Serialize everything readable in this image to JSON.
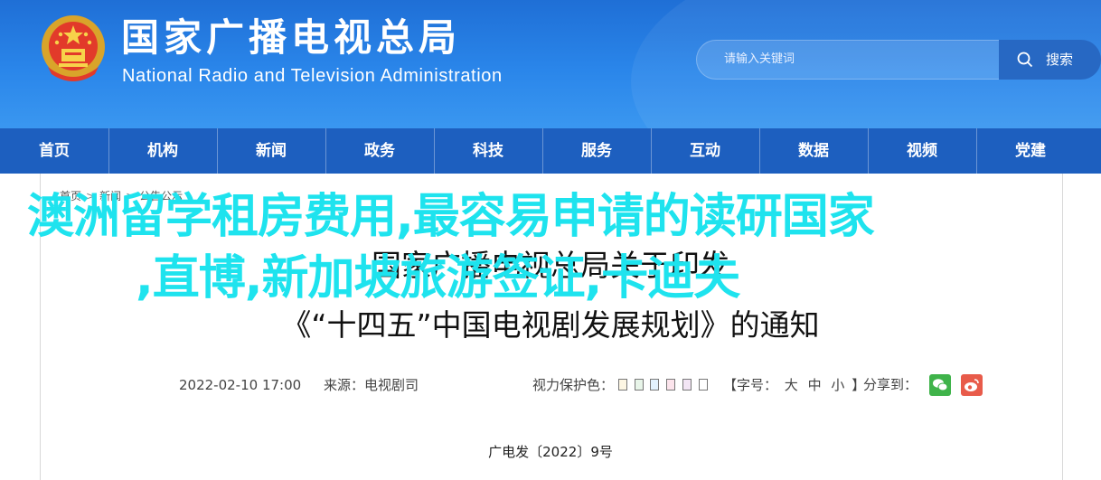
{
  "header": {
    "title_cn": "国家广播电视总局",
    "title_en": "National Radio and Television Administration"
  },
  "search": {
    "placeholder": "请输入关键词",
    "button_label": "搜索"
  },
  "nav": {
    "items": [
      "首页",
      "机构",
      "新闻",
      "政务",
      "科技",
      "服务",
      "互动",
      "数据",
      "视频",
      "党建"
    ]
  },
  "breadcrumb": {
    "items": [
      "首页",
      "新闻",
      "公告公示"
    ]
  },
  "article": {
    "title_line1": "国家广播电视总局关于印发",
    "title_line2": "《“十四五”中国电视剧发展规划》的通知",
    "date": "2022-02-10 17:00",
    "source": "来源：电视剧司",
    "vision_label": "视力保护色：",
    "vision_colors": [
      "#fdf6e3",
      "#e8f5e9",
      "#e3f2fd",
      "#fce4ec",
      "#f3e5f5",
      "#ffffff"
    ],
    "font_size_label": "【字号：",
    "font_sizes": [
      "大",
      "中",
      "小"
    ],
    "font_size_end": "】",
    "share_label": "分享到：",
    "doc_number": "广电发〔2022〕9号"
  },
  "overlay": {
    "line1": "澳洲留学租房费用,最容易申请的读研国家",
    "line2": ",直博,新加坡旅游签证,卡迪夫"
  },
  "colors": {
    "header_blue": "#2a86ea",
    "nav_blue": "#1d5fbf",
    "overlay_cyan": "#1ee3ee",
    "wechat_green": "#3fb34a",
    "weibo_red": "#e85b4a"
  }
}
